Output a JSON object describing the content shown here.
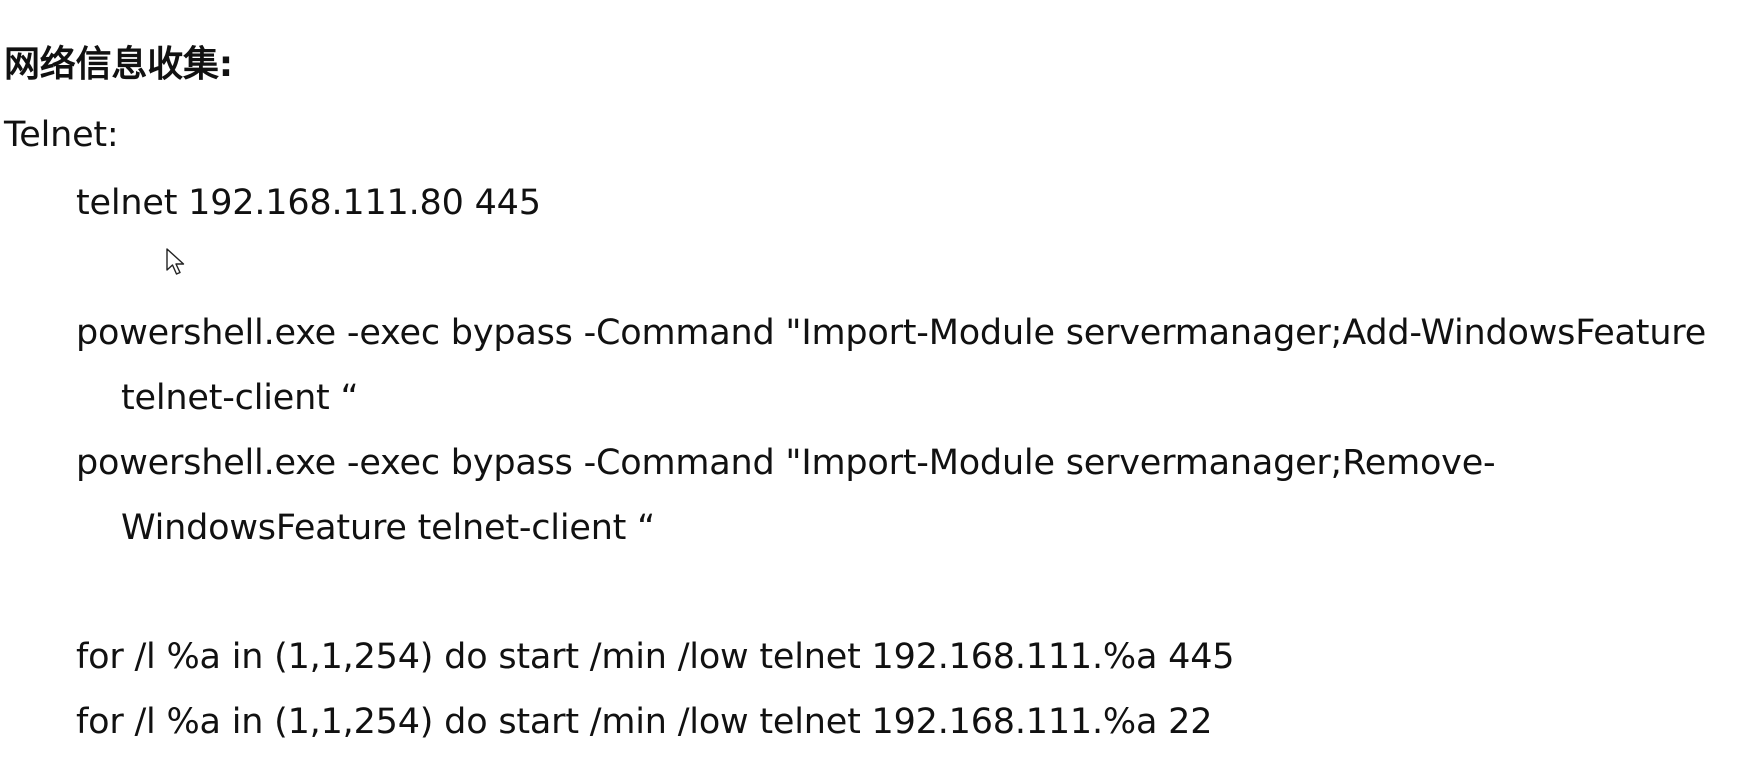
{
  "document": {
    "heading": "网络信息收集:",
    "section": "Telnet:",
    "lines": {
      "telnet_single": "telnet 192.168.111.80 445",
      "ps_add_1": "powershell.exe -exec bypass -Command \"Import-Module servermanager;Add-WindowsFeature",
      "ps_add_2": "telnet-client “",
      "ps_remove_1": "powershell.exe -exec bypass -Command \"Import-Module servermanager;Remove-",
      "ps_remove_2": "WindowsFeature telnet-client “",
      "loop_445": "for /l %a in (1,1,254) do start /min /low telnet 192.168.111.%a 445",
      "loop_22": "for /l %a in (1,1,254) do start /min /low telnet 192.168.111.%a 22"
    }
  },
  "pointer": {
    "icon": "mouse-pointer-icon"
  }
}
